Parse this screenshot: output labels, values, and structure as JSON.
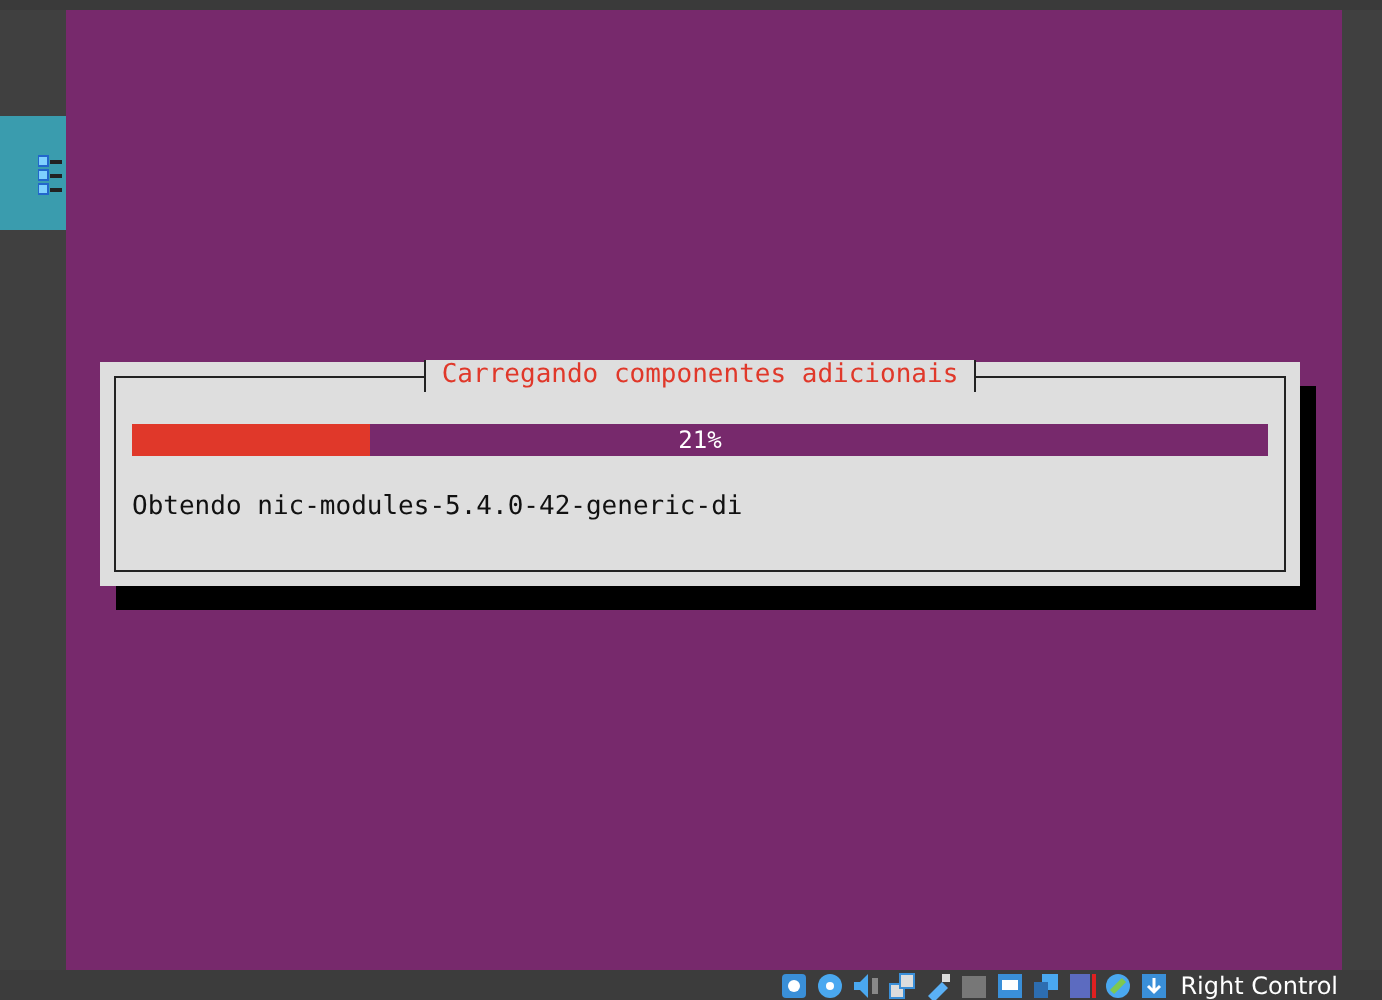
{
  "dialog": {
    "title": "Carregando componentes adicionais",
    "progress": {
      "level": 0.21,
      "reading": "21%"
    },
    "message": "Obtendo nic-modules-5.4.0-42-generic-di"
  },
  "status_bar": {
    "host_key": "Right Control"
  }
}
